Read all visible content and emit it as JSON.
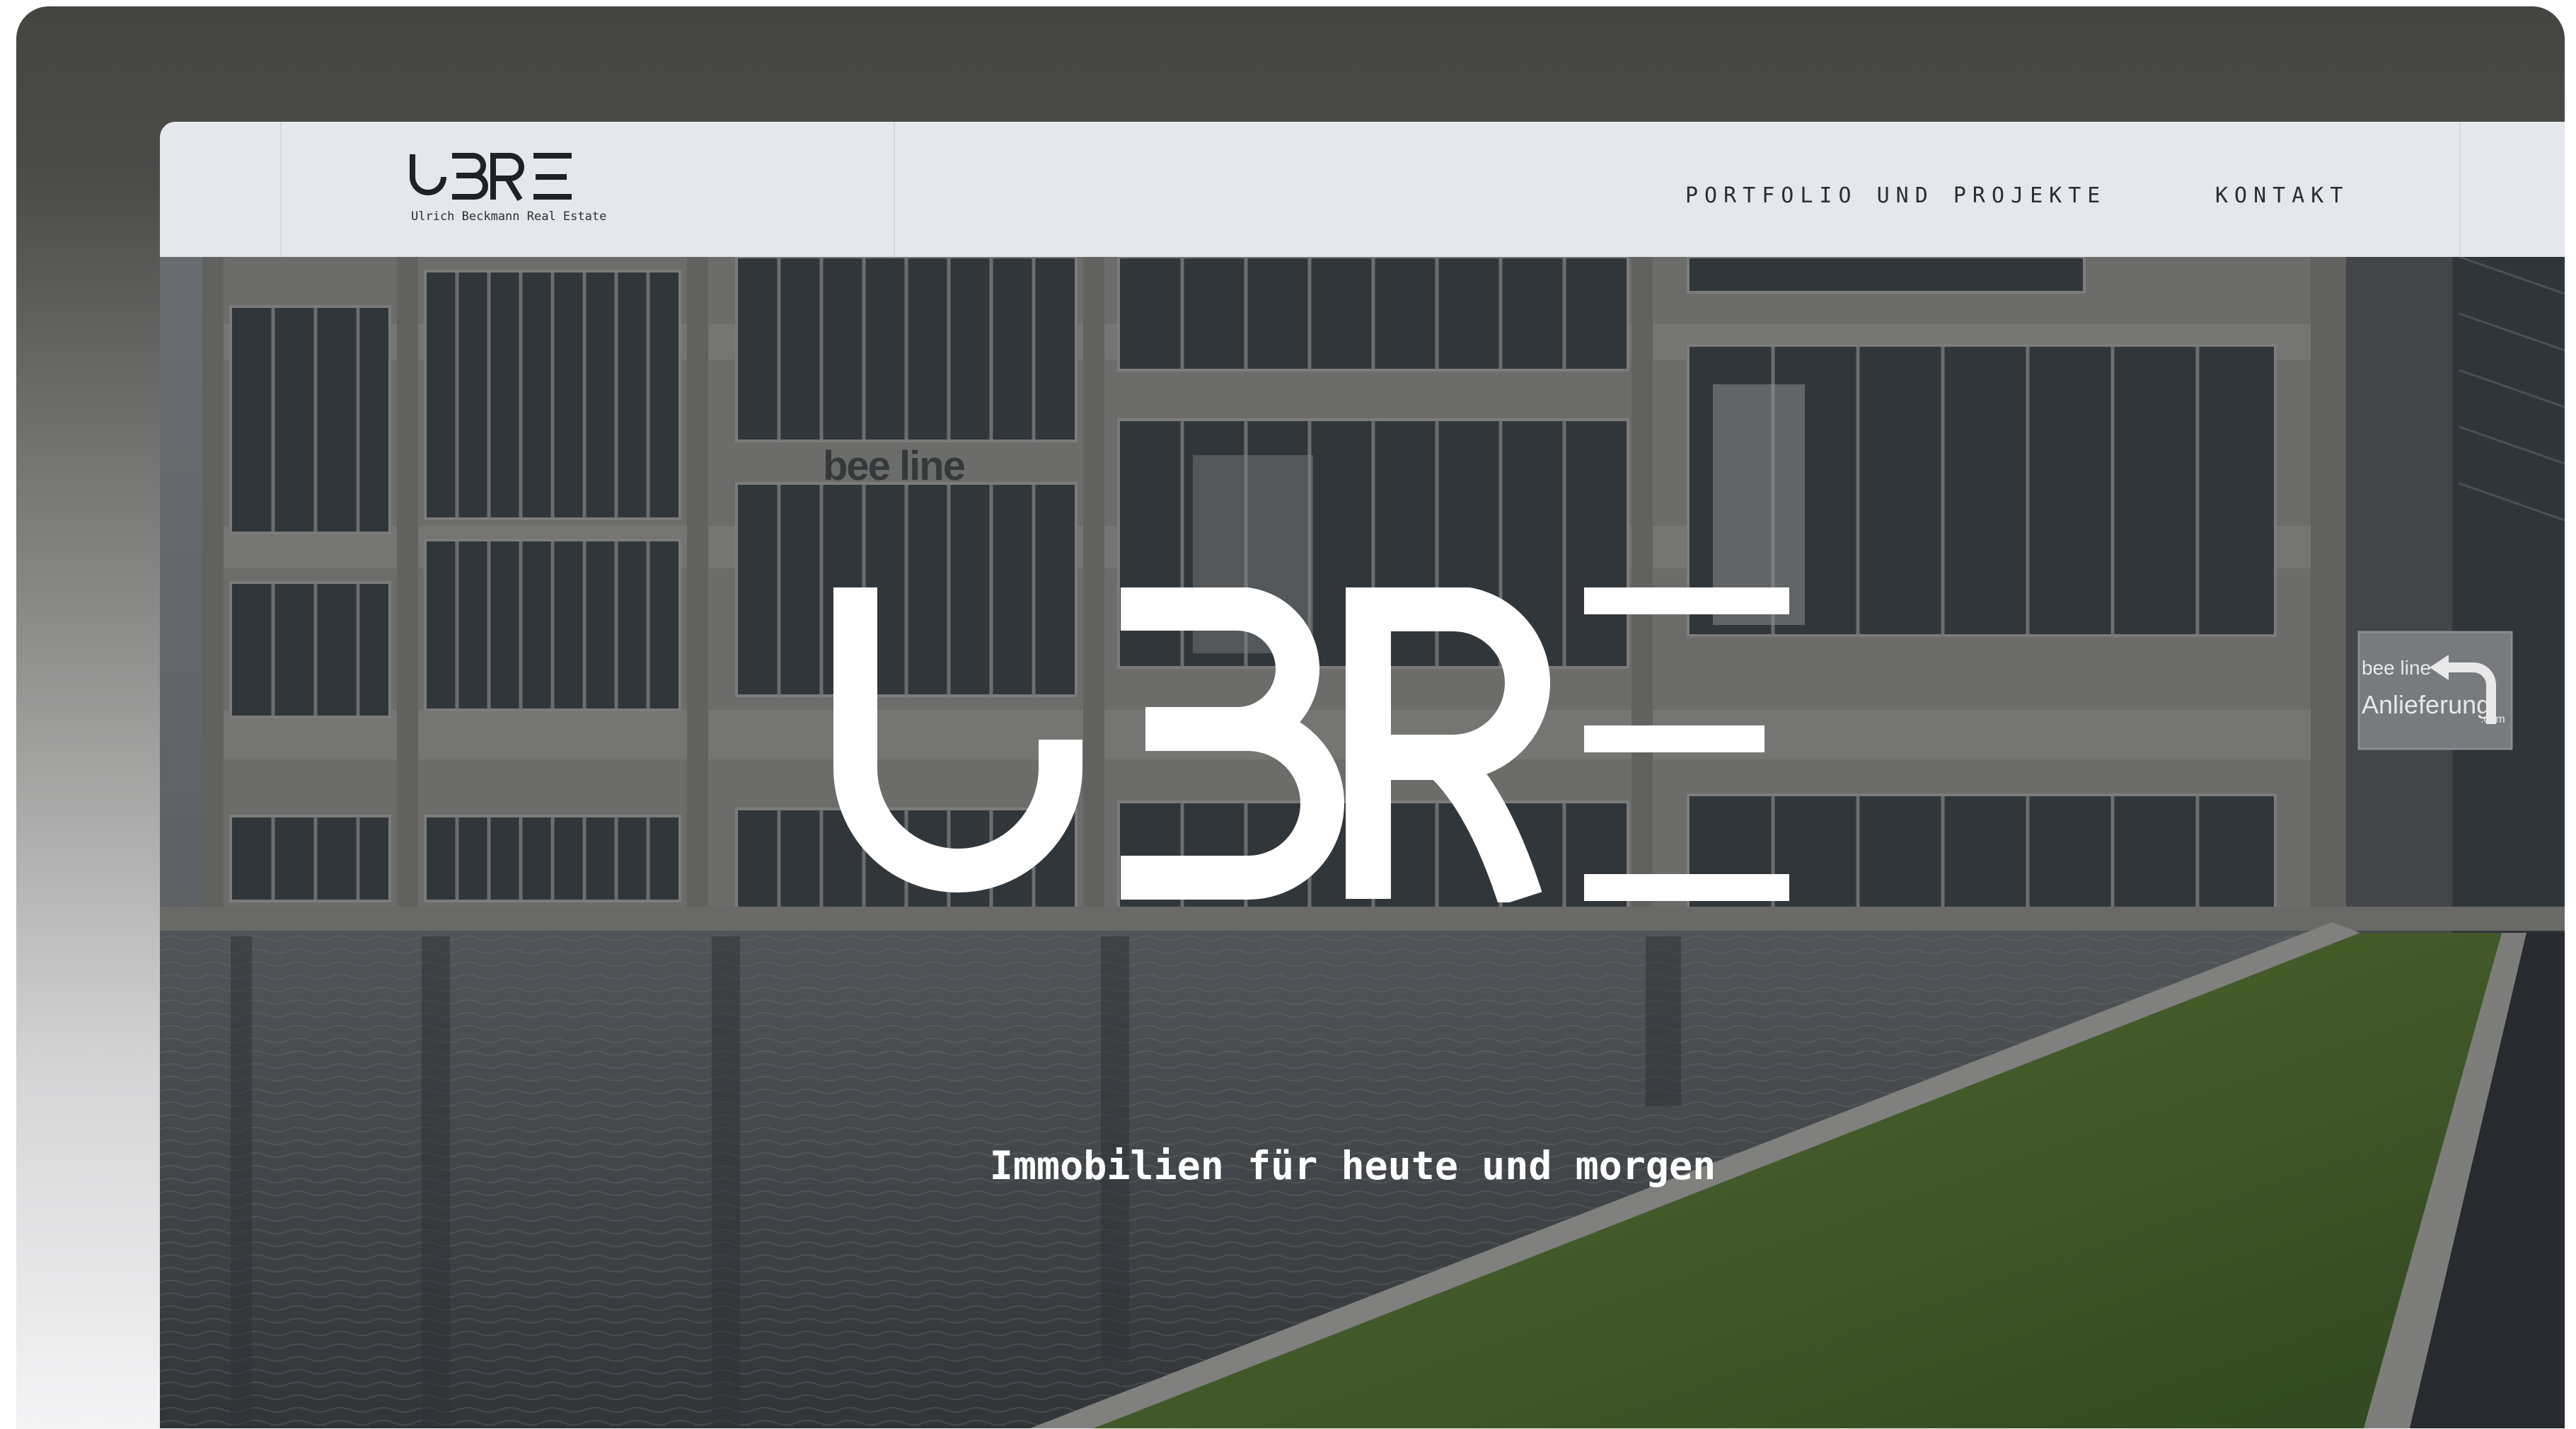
{
  "header": {
    "logo_mark": "UBRE",
    "logo_subtitle": "Ulrich Beckmann Real Estate",
    "nav": [
      {
        "label": "PORTFOLIO UND PROJEKTE"
      },
      {
        "label": "KONTAKT"
      }
    ]
  },
  "hero": {
    "logo_mark": "UBRE",
    "tagline": "Immobilien für heute und morgen",
    "building_sign": "bee line",
    "signpost": {
      "brand": "bee line",
      "label": "Anlieferung",
      "small": ".com"
    }
  },
  "colors": {
    "header_bg": "#e4e8ec",
    "text_dark": "#2a2d31",
    "hero_text": "#ffffff",
    "frame_top": "#444440"
  },
  "icons": {
    "arrow": "turn-left-arrow-icon"
  }
}
